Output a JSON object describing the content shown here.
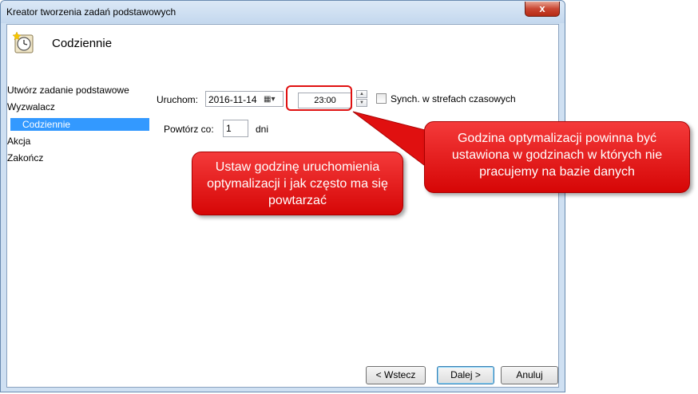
{
  "window": {
    "title": "Kreator tworzenia zadań podstawowych",
    "close_label": "x"
  },
  "header": {
    "title": "Codziennie",
    "icon": "clock-icon"
  },
  "nav": {
    "items": [
      {
        "label": "Utwórz zadanie podstawowe",
        "selected": false
      },
      {
        "label": "Wyzwalacz",
        "selected": false
      },
      {
        "label": "Codziennie",
        "selected": true
      },
      {
        "label": "Akcja",
        "selected": false
      },
      {
        "label": "Zakończ",
        "selected": false
      }
    ]
  },
  "form": {
    "start_label": "Uruchom:",
    "start_date": "2016-11-14",
    "start_time": "23:00",
    "sync_label": "Synch. w strefach czasowych",
    "sync_checked": false,
    "repeat_label": "Powtórz co:",
    "repeat_value": "1",
    "repeat_unit": "dni"
  },
  "buttons": {
    "back": "< Wstecz",
    "next": "Dalej >",
    "cancel": "Anuluj"
  },
  "callouts": {
    "left": "Ustaw godzinę uruchomienia optymalizacji i jak często ma się powtarzać",
    "right": "Godzina optymalizacji powinna być ustawiona w godzinach w których nie pracujemy na bazie danych"
  },
  "colors": {
    "callout": "#e81010",
    "selection": "#3399ff"
  }
}
